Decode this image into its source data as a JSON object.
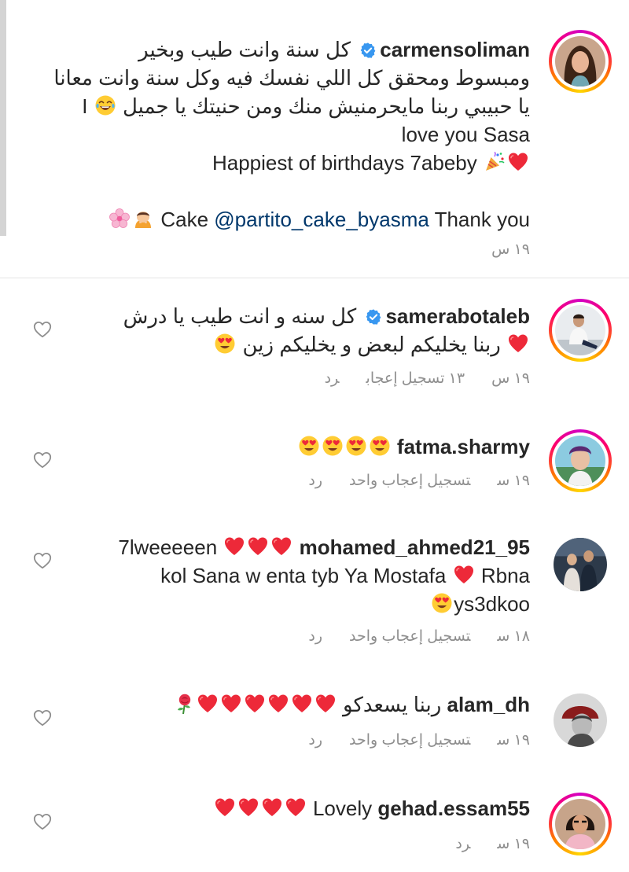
{
  "comments": [
    {
      "id": "c1",
      "username": "carmensoliman",
      "verified": true,
      "lines": [
        "كل سنة وانت طيب وبخير",
        "ومبسوط ومحقق كل اللي نفسك فيه وكل سنة وانت معانا",
        "يا حبيبي ربنا مايحرمنيش منك ومن  حنيتك يا جميل",
        "I",
        "love you Sasa",
        "Happiest of birthdays 7abeby",
        "Cake",
        "@partito_cake_byasma",
        "Thank you"
      ],
      "time": "١٩ س"
    },
    {
      "id": "c2",
      "username": "samerabotaleb",
      "verified": true,
      "lines": [
        "كل سنه و انت طيب يا درش",
        "ربنا يخليكم لبعض و يخليكم زين"
      ],
      "time": "١٩ س",
      "likes": "١٣ تسجيل إعجاب",
      "reply": "رد"
    },
    {
      "id": "c3",
      "username": "fatma.sharmy",
      "verified": false,
      "lines": [],
      "time": "١٩ س",
      "likes": "تسجيل إعجاب واحد",
      "reply": "رد"
    },
    {
      "id": "c4",
      "username": "mohamed_ahmed21_95",
      "verified": false,
      "lines": [
        "7lweeeeen",
        "kol Sana w enta tyb Ya Mostafa",
        "Rbna",
        "ys3dkoo"
      ],
      "time": "١٨ س",
      "likes": "تسجيل إعجاب واحد",
      "reply": "رد"
    },
    {
      "id": "c5",
      "username": "alam_dh",
      "verified": false,
      "lines": [
        "ربنا يسعدكو"
      ],
      "time": "١٩ س",
      "likes": "تسجيل إعجاب واحد",
      "reply": "رد"
    },
    {
      "id": "c6",
      "username": "gehad.essam55",
      "verified": false,
      "lines": [
        "Lovely"
      ],
      "time": "١٩ س",
      "reply": "رد"
    }
  ],
  "icons": {
    "like": "heart-outline-icon",
    "verified": "verified-badge-icon"
  },
  "colors": {
    "text": "#262626",
    "meta": "#8e8e8e",
    "mention": "#00376b",
    "verified": "#3897f0",
    "heart": "#ed2939"
  }
}
